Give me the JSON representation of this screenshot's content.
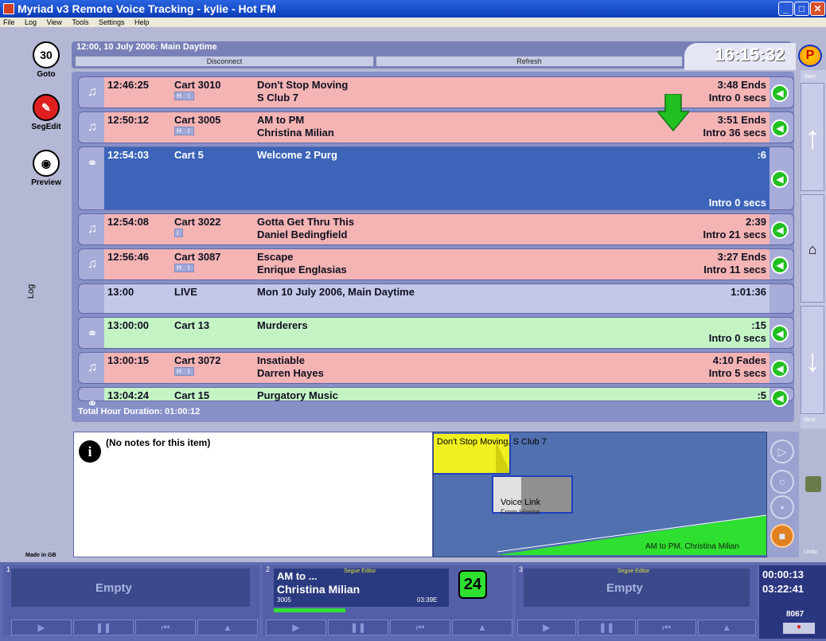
{
  "window": {
    "title": "Myriad v3 Remote Voice Tracking - kylie - Hot FM",
    "menu": [
      "File",
      "Log",
      "View",
      "Tools",
      "Settings",
      "Help"
    ]
  },
  "tools": {
    "goto": {
      "label": "Goto",
      "icon": "30"
    },
    "segedit": {
      "label": "SegEdit"
    },
    "preview": {
      "label": "Preview"
    },
    "log_tab": "Log",
    "made_in": "Made in GB"
  },
  "header": {
    "title": "12:00, 10 July 2006: Main Daytime",
    "disconnect_label": "Disconnect",
    "refresh_label": "Refresh",
    "clock": "16:15:32",
    "logo": "P"
  },
  "log_rows": [
    {
      "time": "12:46:25",
      "cart": "Cart 3010",
      "title": "Don't Stop Moving",
      "artist": "S Club 7",
      "duration": "3:48 Ends",
      "intro": "Intro  0 secs",
      "flags": "H I",
      "type": "pink"
    },
    {
      "time": "12:50:12",
      "cart": "Cart 3005",
      "title": "AM to PM",
      "artist": "Christina Milian",
      "duration": "3:51 Ends",
      "intro": "Intro 36 secs",
      "flags": "H I",
      "type": "pink"
    },
    {
      "time": "12:54:03",
      "cart": "Cart 5",
      "title": "Welcome 2 Purg",
      "artist": "",
      "duration": ":6",
      "intro": "Intro  0 secs",
      "flags": "",
      "type": "blue"
    },
    {
      "time": "12:54:08",
      "cart": "Cart 3022",
      "title": "Gotta Get Thru This",
      "artist": "Daniel Bedingfield",
      "duration": "2:39",
      "intro": "Intro 21 secs",
      "flags": "I",
      "type": "pink"
    },
    {
      "time": "12:56:46",
      "cart": "Cart 3087",
      "title": "Escape",
      "artist": "Enrique Englasias",
      "duration": "3:27 Ends",
      "intro": "Intro 11 secs",
      "flags": "H I",
      "type": "pink"
    },
    {
      "time": "13:00",
      "cart": "LIVE",
      "title": "Mon 10 July 2006, Main Daytime",
      "artist": "",
      "duration": "1:01:36",
      "intro": "",
      "flags": "",
      "type": "grey"
    },
    {
      "time": "13:00:00",
      "cart": "Cart 13",
      "title": "Murderers",
      "artist": "",
      "duration": ":15",
      "intro": "Intro  0 secs",
      "flags": "",
      "type": "green"
    },
    {
      "time": "13:00:15",
      "cart": "Cart 3072",
      "title": "Insatiable",
      "artist": "Darren Hayes",
      "duration": "4:10 Fades",
      "intro": "Intro  5 secs",
      "flags": "H I",
      "type": "pink"
    },
    {
      "time": "13:04:24",
      "cart": "Cart 15",
      "title": "Purgatory Music",
      "artist": "",
      "duration": ":5",
      "intro": "",
      "flags": "",
      "type": "green"
    }
  ],
  "total_duration": "Total Hour Duration:  01:00:12",
  "scroller": {
    "start": "Start",
    "next": "Next",
    "undo": "Undo"
  },
  "notes": {
    "text": "(No notes for this item)"
  },
  "editor": {
    "track1": "Don't Stop Moving, S Club 7",
    "voice_link": "Voice Link",
    "voice_sub": "From Hooke",
    "track2": "AM to PM, Christina Milian"
  },
  "players": {
    "p1": {
      "num": "1",
      "label": "Empty"
    },
    "p2": {
      "num": "2",
      "line1": "AM to ...",
      "line2": "Christina Milian",
      "cart": "3005",
      "time": "03:39E",
      "count": "24",
      "tag": "Segue Editor"
    },
    "p3": {
      "num": "3",
      "label": "Empty",
      "tag": "Segue Editor"
    }
  },
  "counter": {
    "elapsed": "00:00:13",
    "remaining": "03:22:41",
    "code": "8067"
  }
}
